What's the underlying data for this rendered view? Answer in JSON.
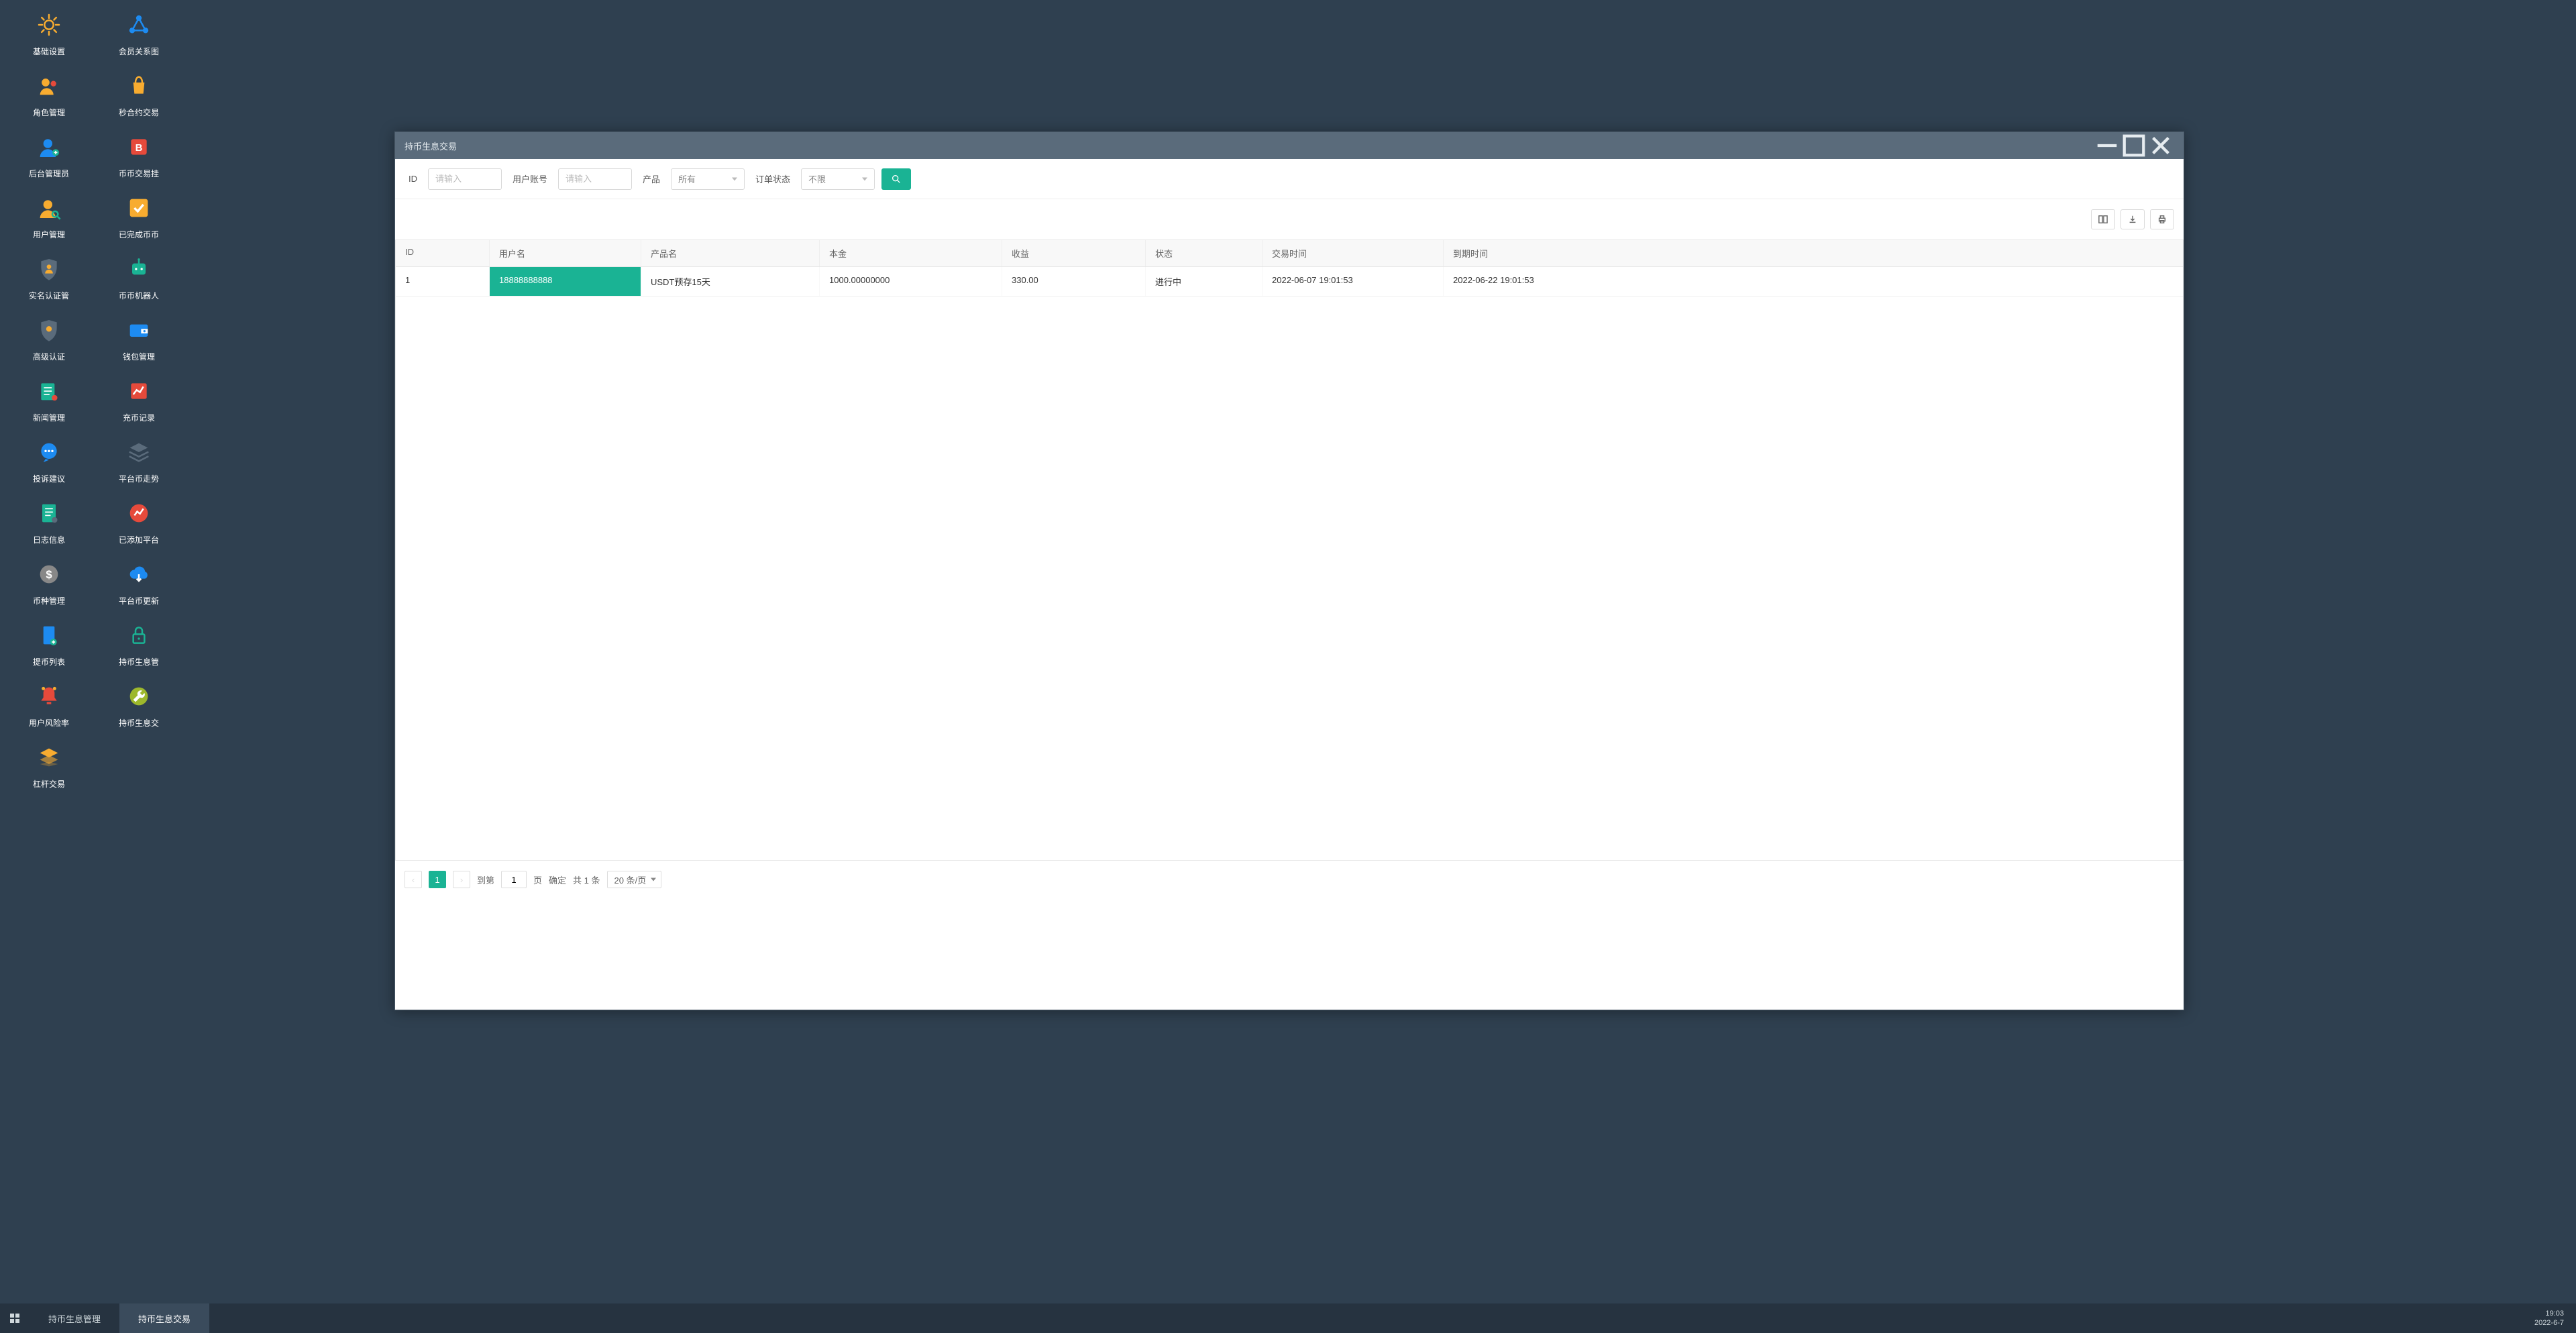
{
  "desktop": {
    "icons": [
      {
        "label": "基础设置",
        "color": "#f8ac30",
        "svg": "gear"
      },
      {
        "label": "会员关系图",
        "color": "#1d8bf1",
        "svg": "network"
      },
      {
        "label": "角色管理",
        "color": "#f8ac30",
        "svg": "people"
      },
      {
        "label": "秒合约交易",
        "color": "#f8ac30",
        "svg": "bag"
      },
      {
        "label": "后台管理员",
        "color": "#1d8bf1",
        "svg": "userplus"
      },
      {
        "label": "币币交易挂",
        "color": "#e64a3b",
        "svg": "blockB"
      },
      {
        "label": "用户管理",
        "color": "#f8ac30",
        "svg": "usersearch"
      },
      {
        "label": "已完成币币",
        "color": "#f8ac30",
        "svg": "checkbox"
      },
      {
        "label": "实名认证管",
        "color": "#5a6b7b",
        "svg": "shielduser"
      },
      {
        "label": "币币机器人",
        "color": "#1ab394",
        "svg": "robot"
      },
      {
        "label": "高级认证",
        "color": "#5a6b7b",
        "svg": "shield2"
      },
      {
        "label": "钱包管理",
        "color": "#1d8bf1",
        "svg": "wallet"
      },
      {
        "label": "新闻管理",
        "color": "#1ab394",
        "svg": "news"
      },
      {
        "label": "充币记录",
        "color": "#e64a3b",
        "svg": "linechart"
      },
      {
        "label": "投诉建议",
        "color": "#1d8bf1",
        "svg": "chat"
      },
      {
        "label": "平台币走势",
        "color": "#5a6b7b",
        "svg": "stack"
      },
      {
        "label": "日志信息",
        "color": "#1ab394",
        "svg": "log"
      },
      {
        "label": "已添加平台",
        "color": "#e64a3b",
        "svg": "trendcircle"
      },
      {
        "label": "币种管理",
        "color": "#888",
        "svg": "dollar"
      },
      {
        "label": "平台币更新",
        "color": "#1d8bf1",
        "svg": "cloud"
      },
      {
        "label": "提币列表",
        "color": "#1d8bf1",
        "svg": "doc"
      },
      {
        "label": "持币生息管",
        "color": "#1ab394",
        "svg": "lock"
      },
      {
        "label": "用户风险率",
        "color": "#e64a3b",
        "svg": "alert"
      },
      {
        "label": "持币生息交",
        "color": "#9db82c",
        "svg": "wrench"
      },
      {
        "label": "杠杆交易",
        "color": "#f8ac30",
        "svg": "layers"
      }
    ]
  },
  "window": {
    "title": "持币生息交易",
    "filters": {
      "id_label": "ID",
      "id_placeholder": "请输入",
      "acct_label": "用户账号",
      "acct_placeholder": "请输入",
      "prod_label": "产品",
      "prod_value": "所有",
      "status_label": "订单状态",
      "status_value": "不限"
    },
    "columns": [
      "ID",
      "用户名",
      "产品名",
      "本金",
      "收益",
      "状态",
      "交易时间",
      "到期时间"
    ],
    "rows": [
      {
        "id": "1",
        "user": "18888888888",
        "prod": "USDT预存15天",
        "amt": "1000.00000000",
        "inc": "330.00",
        "stat": "进行中",
        "tt": "2022-06-07 19:01:53",
        "et": "2022-06-22 19:01:53"
      }
    ],
    "pager": {
      "page": "1",
      "goto_label": "到第",
      "goto_value": "1",
      "goto_unit": "页",
      "confirm": "确定",
      "total": "共 1 条",
      "pagesize": "20 条/页"
    }
  },
  "taskbar": {
    "items": [
      {
        "label": "持币生息管理",
        "active": false
      },
      {
        "label": "持币生息交易",
        "active": true
      }
    ],
    "time": "19:03",
    "date": "2022-6-7"
  }
}
